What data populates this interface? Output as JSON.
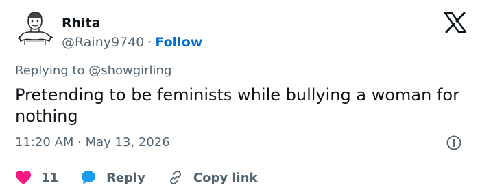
{
  "author": {
    "display_name": "Rhita",
    "handle": "@Rainy9740",
    "separator": "·",
    "follow_label": "Follow"
  },
  "reply_context": "Replying to @showgirling",
  "tweet": {
    "text": "Pretending to be feminists while bullying a woman for nothing",
    "timestamp": "11:20 AM · May 13, 2026"
  },
  "actions": {
    "like_count": "11",
    "reply_label": "Reply",
    "copy_link_label": "Copy link"
  },
  "icons": {
    "brand": "x-logo-icon",
    "info": "info-icon",
    "like": "heart-icon",
    "reply": "speech-bubble-icon",
    "copy": "link-icon"
  },
  "colors": {
    "like": "#f91880",
    "reply": "#1d9bf0",
    "follow": "#006fd6",
    "muted": "#536471",
    "text": "#0f1419"
  }
}
